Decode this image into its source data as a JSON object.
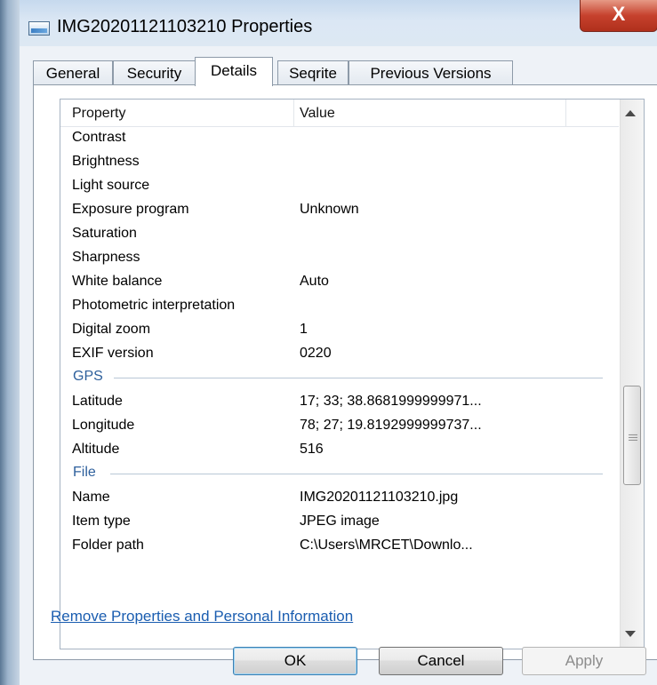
{
  "window": {
    "title": "IMG20201121103210 Properties",
    "close_label": "X"
  },
  "tabs": [
    {
      "label": "General",
      "active": false
    },
    {
      "label": "Security",
      "active": false
    },
    {
      "label": "Details",
      "active": true
    },
    {
      "label": "Seqrite",
      "active": false
    },
    {
      "label": "Previous Versions",
      "active": false
    }
  ],
  "details": {
    "columns": {
      "property": "Property",
      "value": "Value"
    },
    "rows": [
      {
        "property": "Contrast",
        "value": ""
      },
      {
        "property": "Brightness",
        "value": ""
      },
      {
        "property": "Light source",
        "value": ""
      },
      {
        "property": "Exposure program",
        "value": "Unknown"
      },
      {
        "property": "Saturation",
        "value": ""
      },
      {
        "property": "Sharpness",
        "value": ""
      },
      {
        "property": "White balance",
        "value": "Auto"
      },
      {
        "property": "Photometric interpretation",
        "value": ""
      },
      {
        "property": "Digital zoom",
        "value": "1"
      },
      {
        "property": "EXIF version",
        "value": "0220"
      }
    ],
    "groups": [
      {
        "label": "GPS",
        "rows": [
          {
            "property": "Latitude",
            "value": "17; 33; 38.8681999999971..."
          },
          {
            "property": "Longitude",
            "value": "78; 27; 19.8192999999737..."
          },
          {
            "property": "Altitude",
            "value": "516"
          }
        ]
      },
      {
        "label": "File",
        "rows": [
          {
            "property": "Name",
            "value": "IMG20201121103210.jpg"
          },
          {
            "property": "Item type",
            "value": "JPEG image"
          },
          {
            "property": "Folder path",
            "value": "C:\\Users\\MRCET\\Downlo..."
          }
        ]
      }
    ]
  },
  "remove_link": "Remove Properties and Personal Information",
  "buttons": {
    "ok": "OK",
    "cancel": "Cancel",
    "apply": "Apply"
  }
}
